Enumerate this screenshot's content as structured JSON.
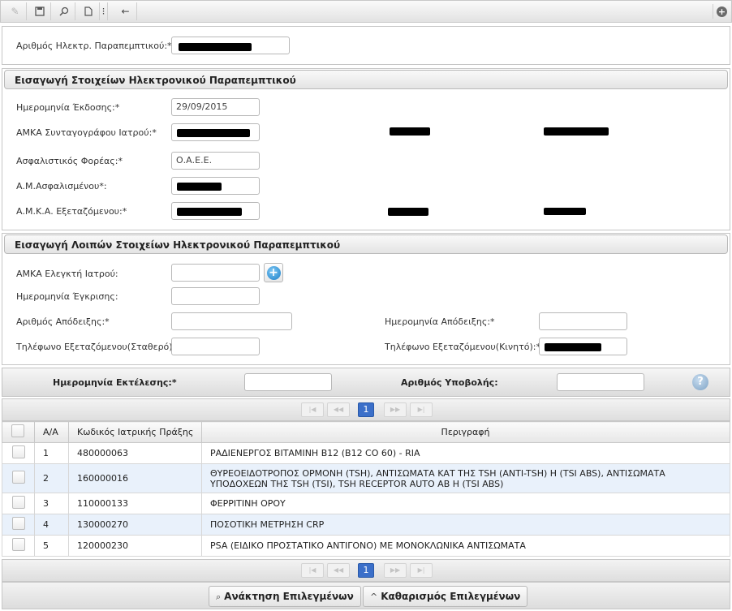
{
  "toolbar": {
    "icons": [
      "pencil-icon",
      "save-icon",
      "search-icon",
      "new-document-icon",
      "separator-icon",
      "back-arrow-icon",
      "add-circle-icon"
    ]
  },
  "referral": {
    "number_label": "Αριθμός Ηλεκτρ. Παραπεμπτικού:*"
  },
  "entry_section": {
    "title": "Εισαγωγή Στοιχείων Ηλεκτρονικού Παραπεμπτικού",
    "issue_date_label": "Ημερομηνία Έκδοσης:*",
    "issue_date_value": "29/09/2015",
    "prescriber_amka_label": "ΑΜΚΑ Συνταγογράφου Ιατρού:*",
    "insurer_label": "Ασφαλιστικός Φορέας:*",
    "insurer_value": "Ο.Α.Ε.Ε.",
    "insured_no_label": "Α.Μ.Ασφαλισμένου*:",
    "patient_amka_label": "Α.Μ.Κ.Α. Εξεταζόμενου:*"
  },
  "other_section": {
    "title": "Εισαγωγή Λοιπών Στοιχείων Ηλεκτρονικού Παραπεμπτικού",
    "auditor_amka_label": "ΑΜΚΑ Ελεγκτή Ιατρού:",
    "approval_date_label": "Ημερομηνία Έγκρισης:",
    "receipt_number_label": "Αριθμός Απόδειξης:*",
    "receipt_date_label": "Ημερομηνία Απόδειξης:*",
    "landline_label": "Τηλέφωνο Εξεταζόμενου(Σταθερό):*",
    "mobile_label": "Τηλέφωνο Εξεταζόμενου(Κινητό):*"
  },
  "filter": {
    "execution_date_label": "Ημερομηνία Εκτέλεσης:*",
    "submission_number_label": "Αριθμός Υποβολής:",
    "help_label": "?"
  },
  "pager": {
    "first": "|◀",
    "prev": "◀◀",
    "current": "1",
    "next": "▶▶",
    "last": "▶|"
  },
  "table": {
    "headers": [
      "Α/Α",
      "Κωδικός Ιατρικής Πράξης",
      "Περιγραφή"
    ],
    "rows": [
      {
        "aa": "1",
        "code": "480000063",
        "desc": "ΡΑΔΙΕΝΕΡΓΟΣ ΒΙΤΑΜΙΝΗ Β12 (Β12 CO 60) - RIA"
      },
      {
        "aa": "2",
        "code": "160000016",
        "desc": "ΘΥΡΕΟΕΙΔΟΤΡΟΠΟΣ ΟΡΜΟΝΗ (TSH), ΑΝΤΙΣΩΜΑΤΑ ΚΑΤ ΤΗΣ TSH (ANTI-TSH) Η (TSI ABS), ΑΝΤΙΣΩΜΑΤΑ ΥΠΟΔΟΧΕΩΝ ΤΗΣ TSH (TSI), TSH RECEPTOR AUTO AB Η (TSI ABS)"
      },
      {
        "aa": "3",
        "code": "110000133",
        "desc": "ΦΕΡΡΙΤΙΝΗ ΟΡΟΥ"
      },
      {
        "aa": "4",
        "code": "130000270",
        "desc": "ΠΟΣΟΤΙΚΗ ΜΕΤΡΗΣΗ CRP"
      },
      {
        "aa": "5",
        "code": "120000230",
        "desc": "PSA (ΕΙΔΙΚΟ ΠΡΟΣΤΑΤΙΚΟ ΑΝΤΙΓΟΝΟ) ΜΕ ΜΟΝΟΚΛΩΝΙΚΑ ΑΝΤΙΣΩΜΑΤΑ"
      }
    ]
  },
  "actions": {
    "retrieve_label": "Ανάκτηση Επιλεγμένων",
    "clear_label": "Καθαρισμός Επιλεγμένων"
  }
}
